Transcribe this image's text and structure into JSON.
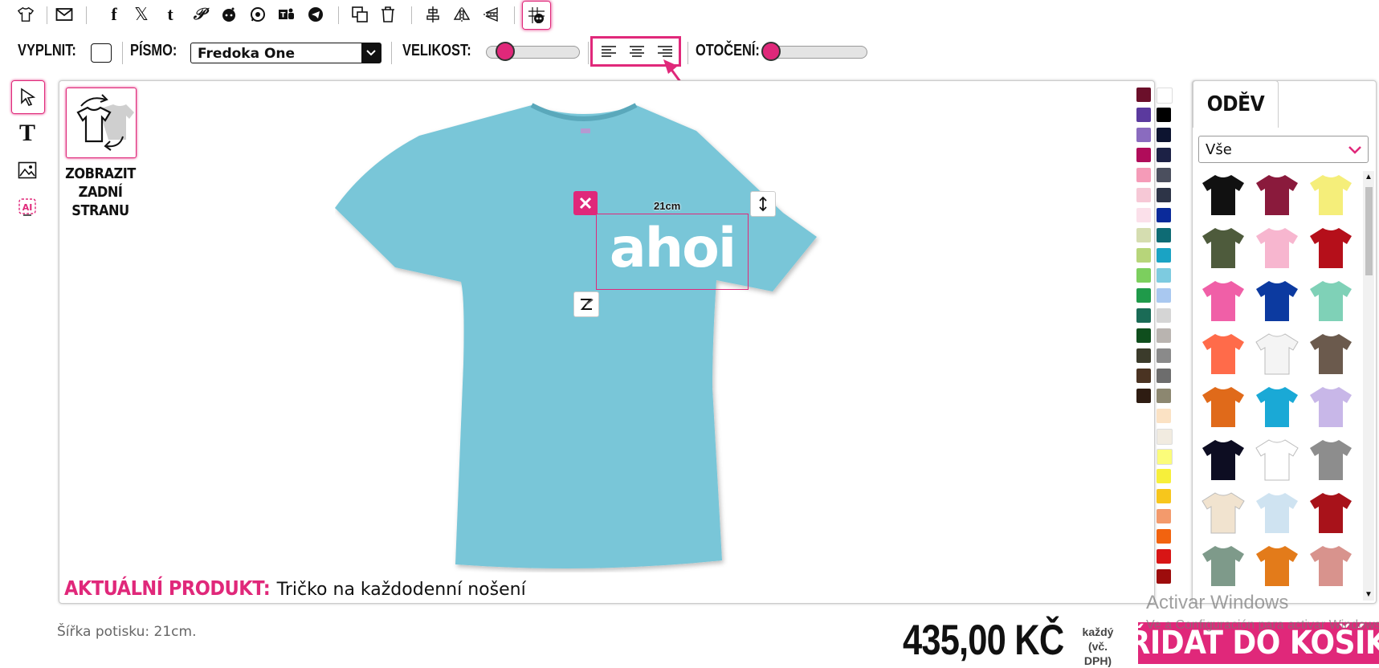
{
  "toolbar": {
    "icons": [
      "shirt-icon",
      "mail-icon",
      "facebook-icon",
      "x-icon",
      "tumblr-icon",
      "pinterest-icon",
      "reddit-icon",
      "whatsapp-icon",
      "teams-icon",
      "telegram-icon",
      "duplicate-icon",
      "trash-icon",
      "align-center-vertical-icon",
      "flip-horizontal-icon",
      "flip-vertical-icon",
      "grid-toggle-icon"
    ]
  },
  "format_bar": {
    "fill_label": "VYPLNIT:",
    "font_label": "PÍSMO:",
    "font_value": "Fredoka One",
    "size_label": "VELIKOST:",
    "rotation_label": "OTOČENÍ:",
    "size_value": 0.15,
    "rotation_value": 0.0
  },
  "back_side": {
    "label_line1": "ZOBRAZIT",
    "label_line2": "ZADNÍ",
    "label_line3": "STRANU"
  },
  "design": {
    "text": "ahoi",
    "width_label": "21cm"
  },
  "current_product": {
    "label": "AKTUÁLNÍ PRODUKT:",
    "value": "Tričko na každodenní nošení"
  },
  "print_width": "Šířka potisku: 21cm.",
  "price": {
    "amount": "435,00 KČ",
    "note_line1": "každý",
    "note_line2": "(vč.",
    "note_line3": "DPH)"
  },
  "add_to_cart": "PŘIDAT DO KOŠÍKU",
  "panel": {
    "tab": "ODĚV",
    "filter_value": "Vše"
  },
  "watermark": {
    "line1": "Activar Windows",
    "line2": "Ve a Configuración para activar Windows."
  },
  "colors": {
    "accent": "#e0287a",
    "shirt": "#79c6d8",
    "palette_col1": [
      "#6b0f2a",
      "#5b3a9e",
      "#8a6bbf",
      "#b00c5a",
      "#f59bb8",
      "#f6c8d6",
      "#fbe0ea",
      "#d5ddb0",
      "#b7d57a",
      "#7ccf5e",
      "#1f9a4a",
      "#1a6b56",
      "#0f4e1d",
      "#3b3b2b",
      "#4a3322",
      "#2e1c12"
    ],
    "palette_col2": [
      "#ffffff",
      "#000000",
      "#0d1430",
      "#1c2145",
      "#4b4f5e",
      "#2d3447",
      "#0a2a9a",
      "#0e6b74",
      "#1aa3c4",
      "#7dcbe0",
      "#a9c8f0",
      "#d5d5d5",
      "#b9b4b0",
      "#8a8a8a",
      "#6d6d6d",
      "#8c8770",
      "#fbe2c4",
      "#f1ebe0",
      "#fbfc7a",
      "#f7ef3a",
      "#f7c61c",
      "#f39a6c",
      "#f2630f",
      "#d81515",
      "#9d0c0c"
    ],
    "products": [
      "#111111",
      "#8a1a3c",
      "#f5ee7a",
      "#4e5b3c",
      "#f7b6cf",
      "#b50f1a",
      "#f05fa7",
      "#0c3aa0",
      "#7fd1b7",
      "#ff6b4a",
      "#f4f4f4",
      "#6b5a4d",
      "#e06a1a",
      "#1aa9d6",
      "#c8b7e8",
      "#0d0d22",
      "#ffffff",
      "#8d8d8d",
      "#f1e3cf",
      "#cfe3f1",
      "#a8121a",
      "#7e9a8a",
      "#e37b1a",
      "#d8938d"
    ]
  }
}
